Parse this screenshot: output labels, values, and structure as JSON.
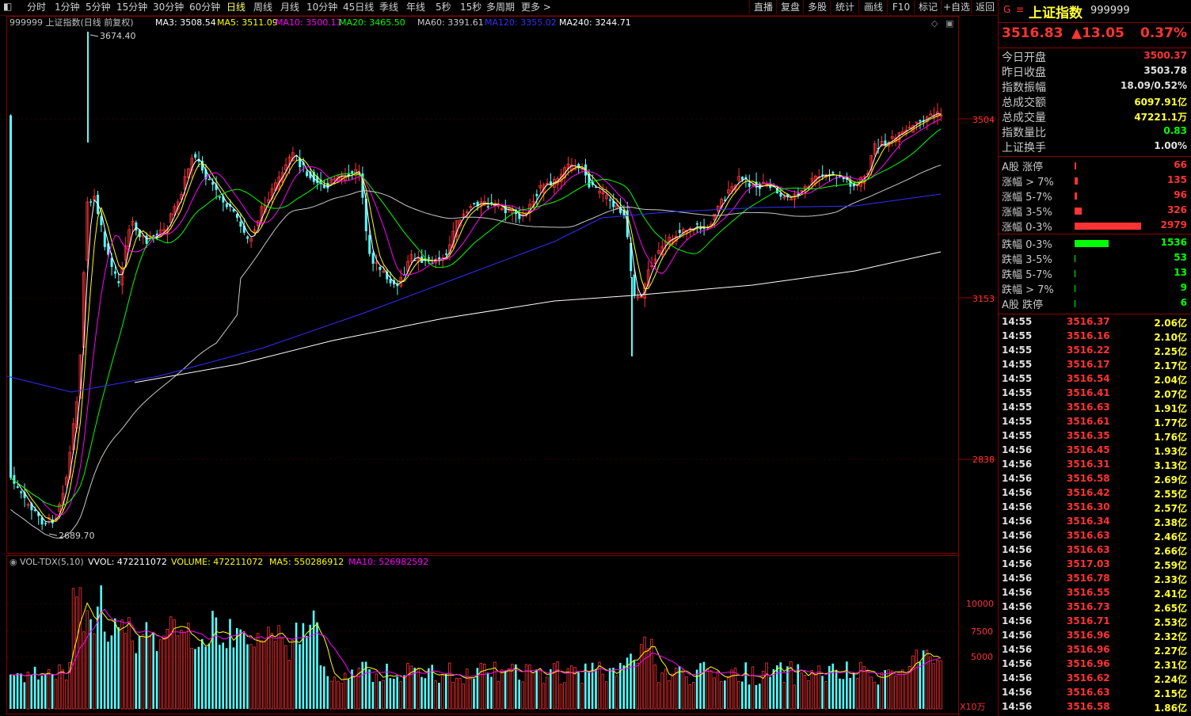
{
  "toolbar": {
    "items": [
      "分时",
      "1分钟",
      "5分钟",
      "15分钟",
      "30分钟",
      "60分钟",
      "日线",
      "周线",
      "月线",
      "10分钟",
      "45日线",
      "季线",
      "年线",
      "5秒",
      "15秒",
      "多周期",
      "更多 >"
    ],
    "active": "日线",
    "right_buttons": [
      "直播",
      "复盘",
      "多股",
      "统计",
      "画线",
      "F10",
      "标记",
      "+自选",
      "返回"
    ]
  },
  "main_chart": {
    "title": "999999 上证指数(日线 前复权)",
    "ma_legend": [
      {
        "label": "MA3: 3508.54",
        "color": "#ffffff"
      },
      {
        "label": "MA5: 3511.09",
        "color": "#ffff00"
      },
      {
        "label": "MA10: 3500.11",
        "color": "#ff00ff"
      },
      {
        "label": "MA20: 3465.50",
        "color": "#00ff00"
      },
      {
        "label": "MA60: 3391.61",
        "color": "#c8c8c8"
      },
      {
        "label": "MA120: 3355.02",
        "color": "#3030ff"
      },
      {
        "label": "MA240: 3244.71",
        "color": "#ffffff"
      }
    ],
    "high_label": "3674.40",
    "low_label": "2689.70",
    "y_ticks": [
      "3504",
      "3153",
      "2838"
    ]
  },
  "volume_chart": {
    "title": "VOL-TDX(5,10)",
    "legend": [
      {
        "label": "VVOL: 472211072",
        "color": "#ffffff"
      },
      {
        "label": "VOLUME: 472211072",
        "color": "#ffff00"
      },
      {
        "label": "MA5: 550286912",
        "color": "#ffff00"
      },
      {
        "label": "MA10: 526982592",
        "color": "#ff00ff"
      }
    ],
    "y_ticks": [
      "10000",
      "7500",
      "5000"
    ],
    "unit": "X10万"
  },
  "quote": {
    "name": "上证指数",
    "code": "999999",
    "price": "3516.83",
    "change": "▲13.05",
    "pct": "0.37%"
  },
  "stats": [
    {
      "label": "今日开盘",
      "value": "3500.37",
      "color": "#ff3333"
    },
    {
      "label": "昨日收盘",
      "value": "3503.78",
      "color": "#e0e0e0"
    },
    {
      "label": "指数振幅",
      "value": "18.09/0.52%",
      "color": "#e0e0e0"
    },
    {
      "label": "总成交额",
      "value": "6097.91亿",
      "color": "#ffff33"
    },
    {
      "label": "总成交量",
      "value": "47221.1万",
      "color": "#ffff33"
    },
    {
      "label": "指数量比",
      "value": "0.83",
      "color": "#00ff00"
    },
    {
      "label": "上证换手",
      "value": "1.00%",
      "color": "#e0e0e0"
    }
  ],
  "distribution": [
    {
      "label": "A股 涨停",
      "value": "66",
      "type": "up",
      "count": 66
    },
    {
      "label": "涨幅 > 7%",
      "value": "135",
      "type": "up",
      "count": 135
    },
    {
      "label": "涨幅 5-7%",
      "value": "96",
      "type": "up",
      "count": 96
    },
    {
      "label": "涨幅 3-5%",
      "value": "326",
      "type": "up",
      "count": 326
    },
    {
      "label": "涨幅 0-3%",
      "value": "2979",
      "type": "up",
      "count": 2979
    },
    {
      "label": "跌幅 0-3%",
      "value": "1536",
      "type": "down",
      "count": 1536
    },
    {
      "label": "跌幅 3-5%",
      "value": "53",
      "type": "down",
      "count": 53
    },
    {
      "label": "跌幅 5-7%",
      "value": "13",
      "type": "down",
      "count": 13
    },
    {
      "label": "跌幅 > 7%",
      "value": "9",
      "type": "down",
      "count": 9
    },
    {
      "label": "A股 跌停",
      "value": "6",
      "type": "down",
      "count": 6
    }
  ],
  "ticks": [
    {
      "t": "14:55",
      "p": "3516.37",
      "v": "2.06亿"
    },
    {
      "t": "14:55",
      "p": "3516.16",
      "v": "2.10亿"
    },
    {
      "t": "14:55",
      "p": "3516.22",
      "v": "2.25亿"
    },
    {
      "t": "14:55",
      "p": "3516.17",
      "v": "2.17亿"
    },
    {
      "t": "14:55",
      "p": "3516.54",
      "v": "2.04亿"
    },
    {
      "t": "14:55",
      "p": "3516.41",
      "v": "2.07亿"
    },
    {
      "t": "14:55",
      "p": "3516.63",
      "v": "1.91亿"
    },
    {
      "t": "14:55",
      "p": "3516.61",
      "v": "1.77亿"
    },
    {
      "t": "14:55",
      "p": "3516.35",
      "v": "1.76亿"
    },
    {
      "t": "14:56",
      "p": "3516.45",
      "v": "1.93亿"
    },
    {
      "t": "14:56",
      "p": "3516.31",
      "v": "3.13亿"
    },
    {
      "t": "14:56",
      "p": "3516.58",
      "v": "2.69亿"
    },
    {
      "t": "14:56",
      "p": "3516.42",
      "v": "2.55亿"
    },
    {
      "t": "14:56",
      "p": "3516.30",
      "v": "2.57亿"
    },
    {
      "t": "14:56",
      "p": "3516.34",
      "v": "2.38亿"
    },
    {
      "t": "14:56",
      "p": "3516.63",
      "v": "2.46亿"
    },
    {
      "t": "14:56",
      "p": "3516.63",
      "v": "2.66亿"
    },
    {
      "t": "14:56",
      "p": "3517.03",
      "v": "2.59亿"
    },
    {
      "t": "14:56",
      "p": "3516.78",
      "v": "2.33亿"
    },
    {
      "t": "14:56",
      "p": "3516.55",
      "v": "2.41亿"
    },
    {
      "t": "14:56",
      "p": "3516.73",
      "v": "2.65亿"
    },
    {
      "t": "14:56",
      "p": "3516.71",
      "v": "2.53亿"
    },
    {
      "t": "14:56",
      "p": "3516.96",
      "v": "2.32亿"
    },
    {
      "t": "14:56",
      "p": "3516.96",
      "v": "2.27亿"
    },
    {
      "t": "14:56",
      "p": "3516.96",
      "v": "2.31亿"
    },
    {
      "t": "14:56",
      "p": "3516.62",
      "v": "2.24亿"
    },
    {
      "t": "14:56",
      "p": "3516.63",
      "v": "2.15亿"
    },
    {
      "t": "14:56",
      "p": "3516.58",
      "v": "1.86亿"
    }
  ],
  "colors": {
    "up": "#ff3333",
    "down": "#00ff00",
    "cyan": "#54ffff",
    "grid": "#8a0000"
  }
}
